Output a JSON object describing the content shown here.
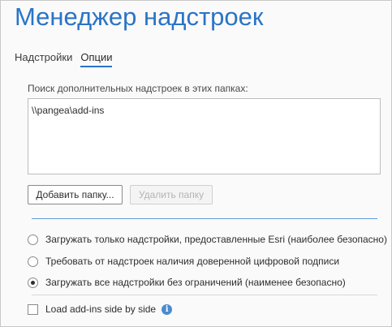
{
  "header": {
    "title": "Менеджер надстроек"
  },
  "tabs": [
    {
      "label": "Надстройки",
      "active": false
    },
    {
      "label": "Опции",
      "active": true
    }
  ],
  "folders": {
    "label": "Поиск дополнительных надстроек в этих папках:",
    "items": [
      "\\\\pangea\\add-ins"
    ],
    "add_button": "Добавить папку...",
    "remove_button": "Удалить папку"
  },
  "security": {
    "options": [
      {
        "label": "Загружать только надстройки, предоставленные Esri (наиболее безопасно)",
        "selected": false
      },
      {
        "label": "Требовать от надстроек наличия доверенной цифровой подписи",
        "selected": false
      },
      {
        "label": "Загружать все надстройки без ограничений (наименее безопасно)",
        "selected": true
      }
    ]
  },
  "side_by_side": {
    "label": "Load add-ins side by side",
    "checked": false,
    "icon": "info-icon"
  },
  "colors": {
    "accent": "#2a74c6",
    "separator": "#5b9bd8",
    "info": "#4a8bd0"
  }
}
